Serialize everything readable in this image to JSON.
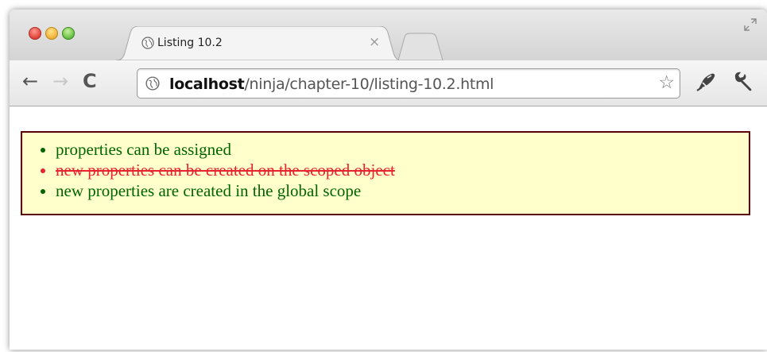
{
  "tab": {
    "title": "Listing 10.2",
    "close_glyph": "×"
  },
  "toolbar": {
    "back_glyph": "←",
    "forward_glyph": "→",
    "reload_glyph": "C",
    "url_host": "localhost",
    "url_path": "/ninja/chapter-10/listing-10.2.html",
    "star_glyph": "☆"
  },
  "icons": {
    "favicon": "globe-icon",
    "bookmark": "star-icon",
    "extension": "pen-extension-icon",
    "settings": "wrench-icon",
    "fullscreen": "resize-icon"
  },
  "results": [
    {
      "text": "properties can be assigned",
      "status": "pass"
    },
    {
      "text": "new properties can be created on the scoped object",
      "status": "fail"
    },
    {
      "text": "new properties are created in the global scope",
      "status": "pass"
    }
  ],
  "colors": {
    "pass": "#006400",
    "fail": "#e8222f",
    "results_background": "#ffffcc",
    "results_border": "#5a0000"
  }
}
